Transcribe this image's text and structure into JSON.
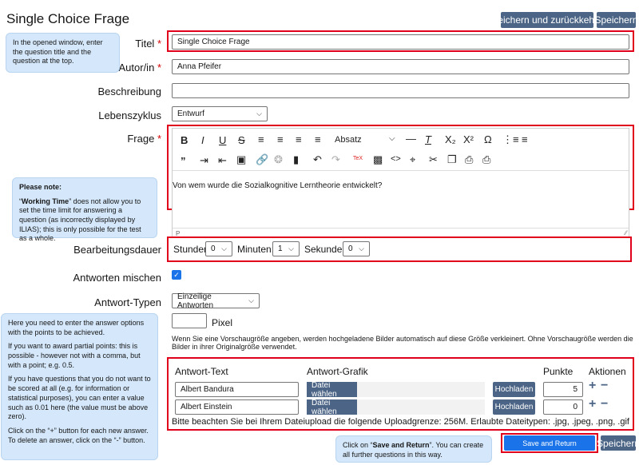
{
  "header": {
    "title": "Single Choice Frage",
    "save_return_label": "Speichern und zurückkehren",
    "save_label": "Speichern"
  },
  "form": {
    "title_label": "Titel",
    "title_value": "Single Choice Frage",
    "author_label": "Autor/in",
    "author_value": "Anna Pfeifer",
    "description_label": "Beschreibung",
    "description_value": "",
    "lifecycle_label": "Lebenszyklus",
    "lifecycle_value": "Entwurf",
    "question_label": "Frage",
    "required_mark": "*",
    "editor": {
      "format_select": "Absatz",
      "content": "Von wem wurde die Sozialkognitive Lerntheorie entwickelt?",
      "status_path": "P"
    },
    "working_time_label": "Bearbeitungsdauer",
    "hours_label": "Stunden:",
    "hours_value": "0",
    "minutes_label": "Minuten:",
    "minutes_value": "1",
    "seconds_label": "Sekunden:",
    "seconds_value": "0",
    "shuffle_label": "Antworten mischen",
    "shuffle_checked": true,
    "answer_types_label": "Antwort-Typen",
    "answer_types_value": "Einzeilige Antworten",
    "pixel_value": "",
    "pixel_unit": "Pixel",
    "preview_info": "Wenn Sie eine Vorschaugröße angeben, werden hochgeladene Bilder automatisch auf diese Größe verkleinert. Ohne Vorschaugröße werden die Bilder in ihrer Originalgröße verwendet."
  },
  "answers": {
    "col_text": "Antwort-Text",
    "col_image": "Antwort-Grafik",
    "col_points": "Punkte",
    "col_actions": "Aktionen",
    "choose_file_label": "Datei wählen",
    "upload_label": "Hochladen",
    "rows": [
      {
        "text": "Albert Bandura",
        "points": "5"
      },
      {
        "text": "Albert Einstein",
        "points": "0"
      }
    ],
    "upload_note": "Bitte beachten Sie bei Ihrem Dateiupload die folgende Uploadgrenze: 256M. Erlaubte Dateitypen: .jpg, .jpeg, .png, .gif"
  },
  "footer": {
    "save_return_label": "Save and Return",
    "save_label": "Speichern"
  },
  "callouts": {
    "title_hint": "In the opened window, enter the question title and the question at the top.",
    "note_heading": "Please note:",
    "note_bold": "Working Time",
    "note_text_pre": "“",
    "note_text_post": "” does not allow you to set the time limit for answering a question (as incorrectly displayed by ILIAS); this is only possible for the test as a whole.",
    "answers_p1": "Here you need to enter the answer options with the points to be achieved.",
    "answers_p2": "If you want to award partial points: this is possible - however not with a comma, but with a point; e.g. 0.5.",
    "answers_p3": "If you have questions that you do not want to be scored at all (e.g. for information or statistical purposes), you can enter a value such as 0.01 here (the value must be above zero).",
    "answers_p4": "Click on the “+” button for each new answer. To delete an answer, click on the “-” button.",
    "save_hint_pre": "Click on “",
    "save_hint_bold": "Save and Return",
    "save_hint_post": "”. You can create all further questions in this way."
  },
  "colors": {
    "primary": "#4c6586",
    "highlight": "#e0001b",
    "callout": "#d5e8fb",
    "required": "#d40000",
    "footer_save": "#1a73e8"
  }
}
